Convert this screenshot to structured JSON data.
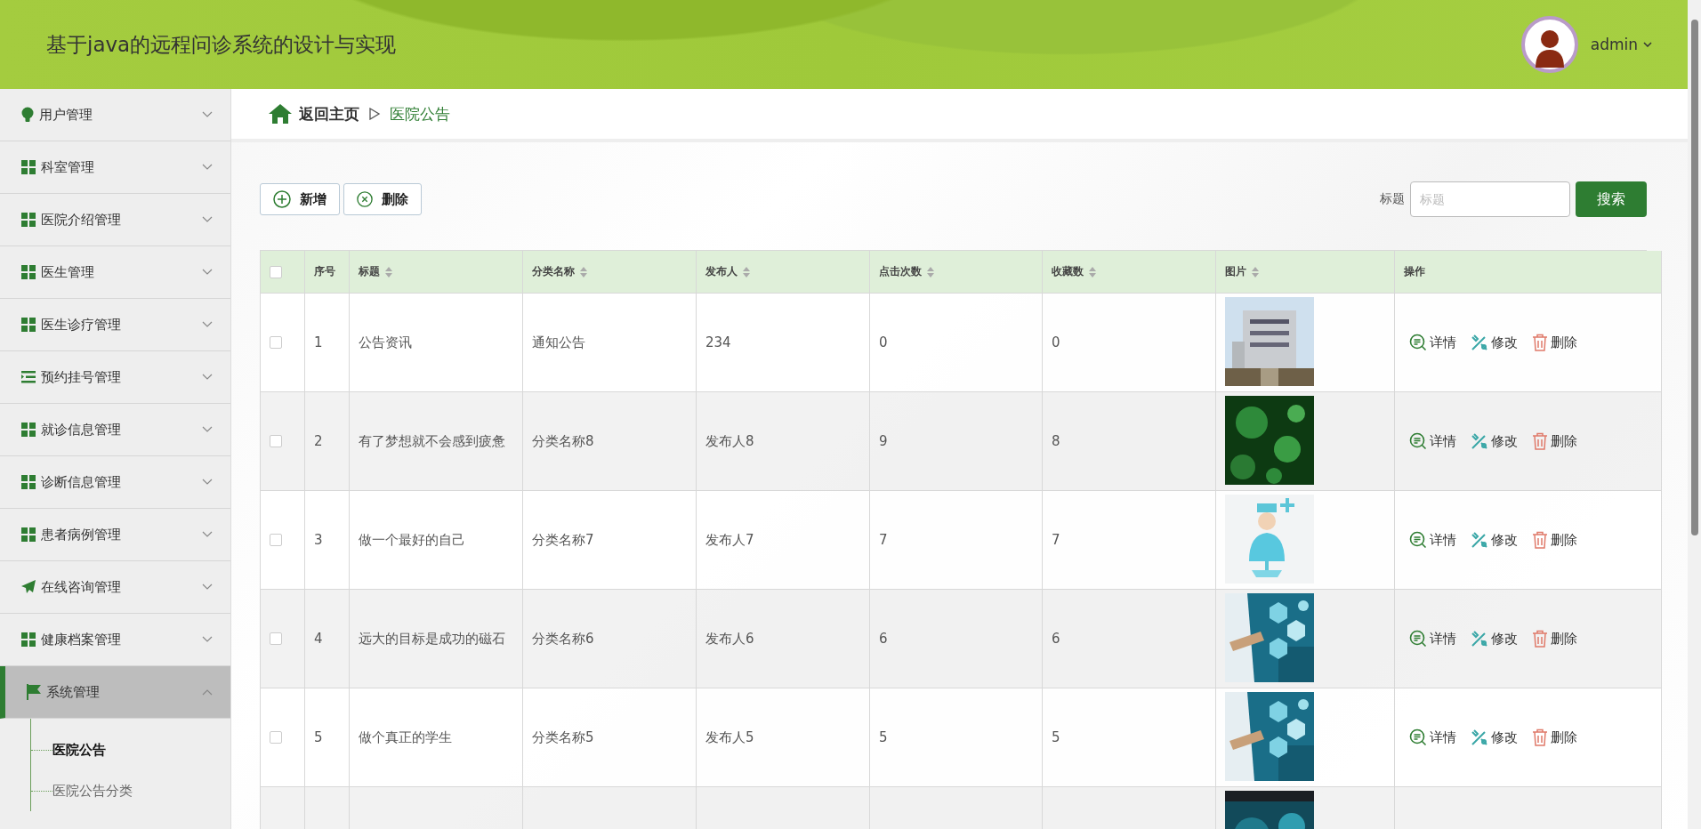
{
  "header": {
    "title": "基于java的远程问诊系统的设计与实现",
    "user": "admin"
  },
  "sidebar": {
    "items": [
      {
        "label": "用户管理",
        "kind": "bulb",
        "expanded": false
      },
      {
        "label": "科室管理",
        "kind": "grid",
        "expanded": false
      },
      {
        "label": "医院介绍管理",
        "kind": "grid",
        "expanded": false
      },
      {
        "label": "医生管理",
        "kind": "grid",
        "expanded": false
      },
      {
        "label": "医生诊疗管理",
        "kind": "grid",
        "expanded": false
      },
      {
        "label": "预约挂号管理",
        "kind": "list",
        "expanded": false
      },
      {
        "label": "就诊信息管理",
        "kind": "grid",
        "expanded": false
      },
      {
        "label": "诊断信息管理",
        "kind": "grid",
        "expanded": false
      },
      {
        "label": "患者病例管理",
        "kind": "grid",
        "expanded": false
      },
      {
        "label": "在线咨询管理",
        "kind": "plane",
        "expanded": false
      },
      {
        "label": "健康档案管理",
        "kind": "grid",
        "expanded": false
      },
      {
        "label": "系统管理",
        "kind": "flag",
        "expanded": true,
        "children": [
          {
            "label": "医院公告",
            "selected": true
          },
          {
            "label": "医院公告分类",
            "selected": false
          }
        ]
      }
    ]
  },
  "breadcrumb": {
    "home": "返回主页",
    "current": "医院公告"
  },
  "toolbar": {
    "buttons": [
      {
        "label": "新增",
        "kind": "add"
      },
      {
        "label": "删除",
        "kind": "delete"
      }
    ]
  },
  "search": {
    "label": "标题",
    "placeholder": "标题",
    "button": "搜索"
  },
  "table": {
    "select_all": {
      "checked": false
    },
    "columns": [
      {
        "label": "序号",
        "sortable": false
      },
      {
        "label": "标题",
        "sortable": true
      },
      {
        "label": "分类名称",
        "sortable": true
      },
      {
        "label": "发布人",
        "sortable": true
      },
      {
        "label": "点击次数",
        "sortable": true
      },
      {
        "label": "收藏数",
        "sortable": true
      },
      {
        "label": "图片",
        "sortable": true
      },
      {
        "label": "操作",
        "sortable": false
      }
    ],
    "rows": [
      {
        "checked": false,
        "cells": [
          "1",
          "公告资讯",
          "通知公告",
          "234",
          "0",
          "0"
        ],
        "picture": {
          "kind": "picture"
        },
        "actions": [
          {
            "label": "详情",
            "kind": "detail"
          },
          {
            "label": "修改",
            "kind": "edit"
          },
          {
            "label": "删除",
            "kind": "delete"
          }
        ]
      },
      {
        "checked": false,
        "cells": [
          "2",
          "有了梦想就不会感到疲惫",
          "分类名称8",
          "发布人8",
          "9",
          "8"
        ],
        "picture": {
          "kind": "picture"
        },
        "actions": [
          {
            "label": "详情",
            "kind": "detail"
          },
          {
            "label": "修改",
            "kind": "edit"
          },
          {
            "label": "删除",
            "kind": "delete"
          }
        ]
      },
      {
        "checked": false,
        "cells": [
          "3",
          "做一个最好的自己",
          "分类名称7",
          "发布人7",
          "7",
          "7"
        ],
        "picture": {
          "kind": "picture"
        },
        "actions": [
          {
            "label": "详情",
            "kind": "detail"
          },
          {
            "label": "修改",
            "kind": "edit"
          },
          {
            "label": "删除",
            "kind": "delete"
          }
        ]
      },
      {
        "checked": false,
        "cells": [
          "4",
          "远大的目标是成功的磁石",
          "分类名称6",
          "发布人6",
          "6",
          "6"
        ],
        "picture": {
          "kind": "picture"
        },
        "actions": [
          {
            "label": "详情",
            "kind": "detail"
          },
          {
            "label": "修改",
            "kind": "edit"
          },
          {
            "label": "删除",
            "kind": "delete"
          }
        ]
      },
      {
        "checked": false,
        "cells": [
          "5",
          "做个真正的学生",
          "分类名称5",
          "发布人5",
          "5",
          "5"
        ],
        "picture": {
          "kind": "picture"
        },
        "actions": [
          {
            "label": "详情",
            "kind": "detail"
          },
          {
            "label": "修改",
            "kind": "edit"
          },
          {
            "label": "删除",
            "kind": "delete"
          }
        ]
      },
      {
        "picture": {
          "kind": "picture"
        }
      }
    ]
  }
}
